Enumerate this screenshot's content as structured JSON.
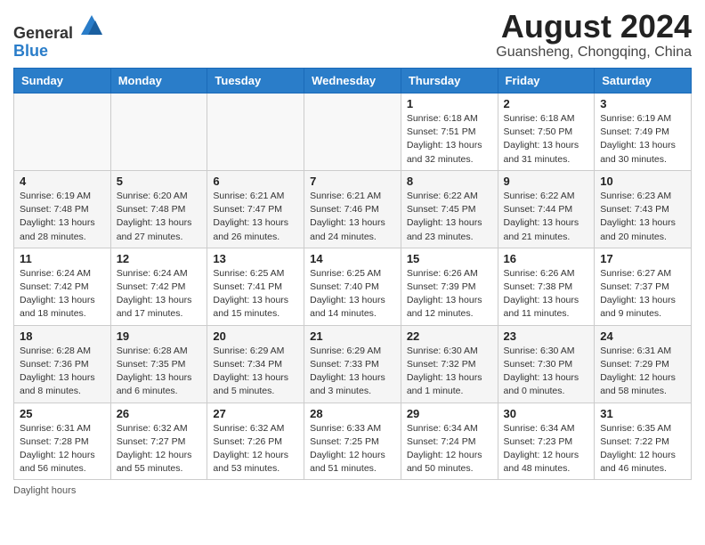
{
  "header": {
    "logo_general": "General",
    "logo_blue": "Blue",
    "main_title": "August 2024",
    "sub_title": "Guansheng, Chongqing, China"
  },
  "weekdays": [
    "Sunday",
    "Monday",
    "Tuesday",
    "Wednesday",
    "Thursday",
    "Friday",
    "Saturday"
  ],
  "weeks": [
    [
      {
        "day": "",
        "info": ""
      },
      {
        "day": "",
        "info": ""
      },
      {
        "day": "",
        "info": ""
      },
      {
        "day": "",
        "info": ""
      },
      {
        "day": "1",
        "info": "Sunrise: 6:18 AM\nSunset: 7:51 PM\nDaylight: 13 hours and 32 minutes."
      },
      {
        "day": "2",
        "info": "Sunrise: 6:18 AM\nSunset: 7:50 PM\nDaylight: 13 hours and 31 minutes."
      },
      {
        "day": "3",
        "info": "Sunrise: 6:19 AM\nSunset: 7:49 PM\nDaylight: 13 hours and 30 minutes."
      }
    ],
    [
      {
        "day": "4",
        "info": "Sunrise: 6:19 AM\nSunset: 7:48 PM\nDaylight: 13 hours and 28 minutes."
      },
      {
        "day": "5",
        "info": "Sunrise: 6:20 AM\nSunset: 7:48 PM\nDaylight: 13 hours and 27 minutes."
      },
      {
        "day": "6",
        "info": "Sunrise: 6:21 AM\nSunset: 7:47 PM\nDaylight: 13 hours and 26 minutes."
      },
      {
        "day": "7",
        "info": "Sunrise: 6:21 AM\nSunset: 7:46 PM\nDaylight: 13 hours and 24 minutes."
      },
      {
        "day": "8",
        "info": "Sunrise: 6:22 AM\nSunset: 7:45 PM\nDaylight: 13 hours and 23 minutes."
      },
      {
        "day": "9",
        "info": "Sunrise: 6:22 AM\nSunset: 7:44 PM\nDaylight: 13 hours and 21 minutes."
      },
      {
        "day": "10",
        "info": "Sunrise: 6:23 AM\nSunset: 7:43 PM\nDaylight: 13 hours and 20 minutes."
      }
    ],
    [
      {
        "day": "11",
        "info": "Sunrise: 6:24 AM\nSunset: 7:42 PM\nDaylight: 13 hours and 18 minutes."
      },
      {
        "day": "12",
        "info": "Sunrise: 6:24 AM\nSunset: 7:42 PM\nDaylight: 13 hours and 17 minutes."
      },
      {
        "day": "13",
        "info": "Sunrise: 6:25 AM\nSunset: 7:41 PM\nDaylight: 13 hours and 15 minutes."
      },
      {
        "day": "14",
        "info": "Sunrise: 6:25 AM\nSunset: 7:40 PM\nDaylight: 13 hours and 14 minutes."
      },
      {
        "day": "15",
        "info": "Sunrise: 6:26 AM\nSunset: 7:39 PM\nDaylight: 13 hours and 12 minutes."
      },
      {
        "day": "16",
        "info": "Sunrise: 6:26 AM\nSunset: 7:38 PM\nDaylight: 13 hours and 11 minutes."
      },
      {
        "day": "17",
        "info": "Sunrise: 6:27 AM\nSunset: 7:37 PM\nDaylight: 13 hours and 9 minutes."
      }
    ],
    [
      {
        "day": "18",
        "info": "Sunrise: 6:28 AM\nSunset: 7:36 PM\nDaylight: 13 hours and 8 minutes."
      },
      {
        "day": "19",
        "info": "Sunrise: 6:28 AM\nSunset: 7:35 PM\nDaylight: 13 hours and 6 minutes."
      },
      {
        "day": "20",
        "info": "Sunrise: 6:29 AM\nSunset: 7:34 PM\nDaylight: 13 hours and 5 minutes."
      },
      {
        "day": "21",
        "info": "Sunrise: 6:29 AM\nSunset: 7:33 PM\nDaylight: 13 hours and 3 minutes."
      },
      {
        "day": "22",
        "info": "Sunrise: 6:30 AM\nSunset: 7:32 PM\nDaylight: 13 hours and 1 minute."
      },
      {
        "day": "23",
        "info": "Sunrise: 6:30 AM\nSunset: 7:30 PM\nDaylight: 13 hours and 0 minutes."
      },
      {
        "day": "24",
        "info": "Sunrise: 6:31 AM\nSunset: 7:29 PM\nDaylight: 12 hours and 58 minutes."
      }
    ],
    [
      {
        "day": "25",
        "info": "Sunrise: 6:31 AM\nSunset: 7:28 PM\nDaylight: 12 hours and 56 minutes."
      },
      {
        "day": "26",
        "info": "Sunrise: 6:32 AM\nSunset: 7:27 PM\nDaylight: 12 hours and 55 minutes."
      },
      {
        "day": "27",
        "info": "Sunrise: 6:32 AM\nSunset: 7:26 PM\nDaylight: 12 hours and 53 minutes."
      },
      {
        "day": "28",
        "info": "Sunrise: 6:33 AM\nSunset: 7:25 PM\nDaylight: 12 hours and 51 minutes."
      },
      {
        "day": "29",
        "info": "Sunrise: 6:34 AM\nSunset: 7:24 PM\nDaylight: 12 hours and 50 minutes."
      },
      {
        "day": "30",
        "info": "Sunrise: 6:34 AM\nSunset: 7:23 PM\nDaylight: 12 hours and 48 minutes."
      },
      {
        "day": "31",
        "info": "Sunrise: 6:35 AM\nSunset: 7:22 PM\nDaylight: 12 hours and 46 minutes."
      }
    ]
  ],
  "footer": {
    "daylight_label": "Daylight hours"
  }
}
